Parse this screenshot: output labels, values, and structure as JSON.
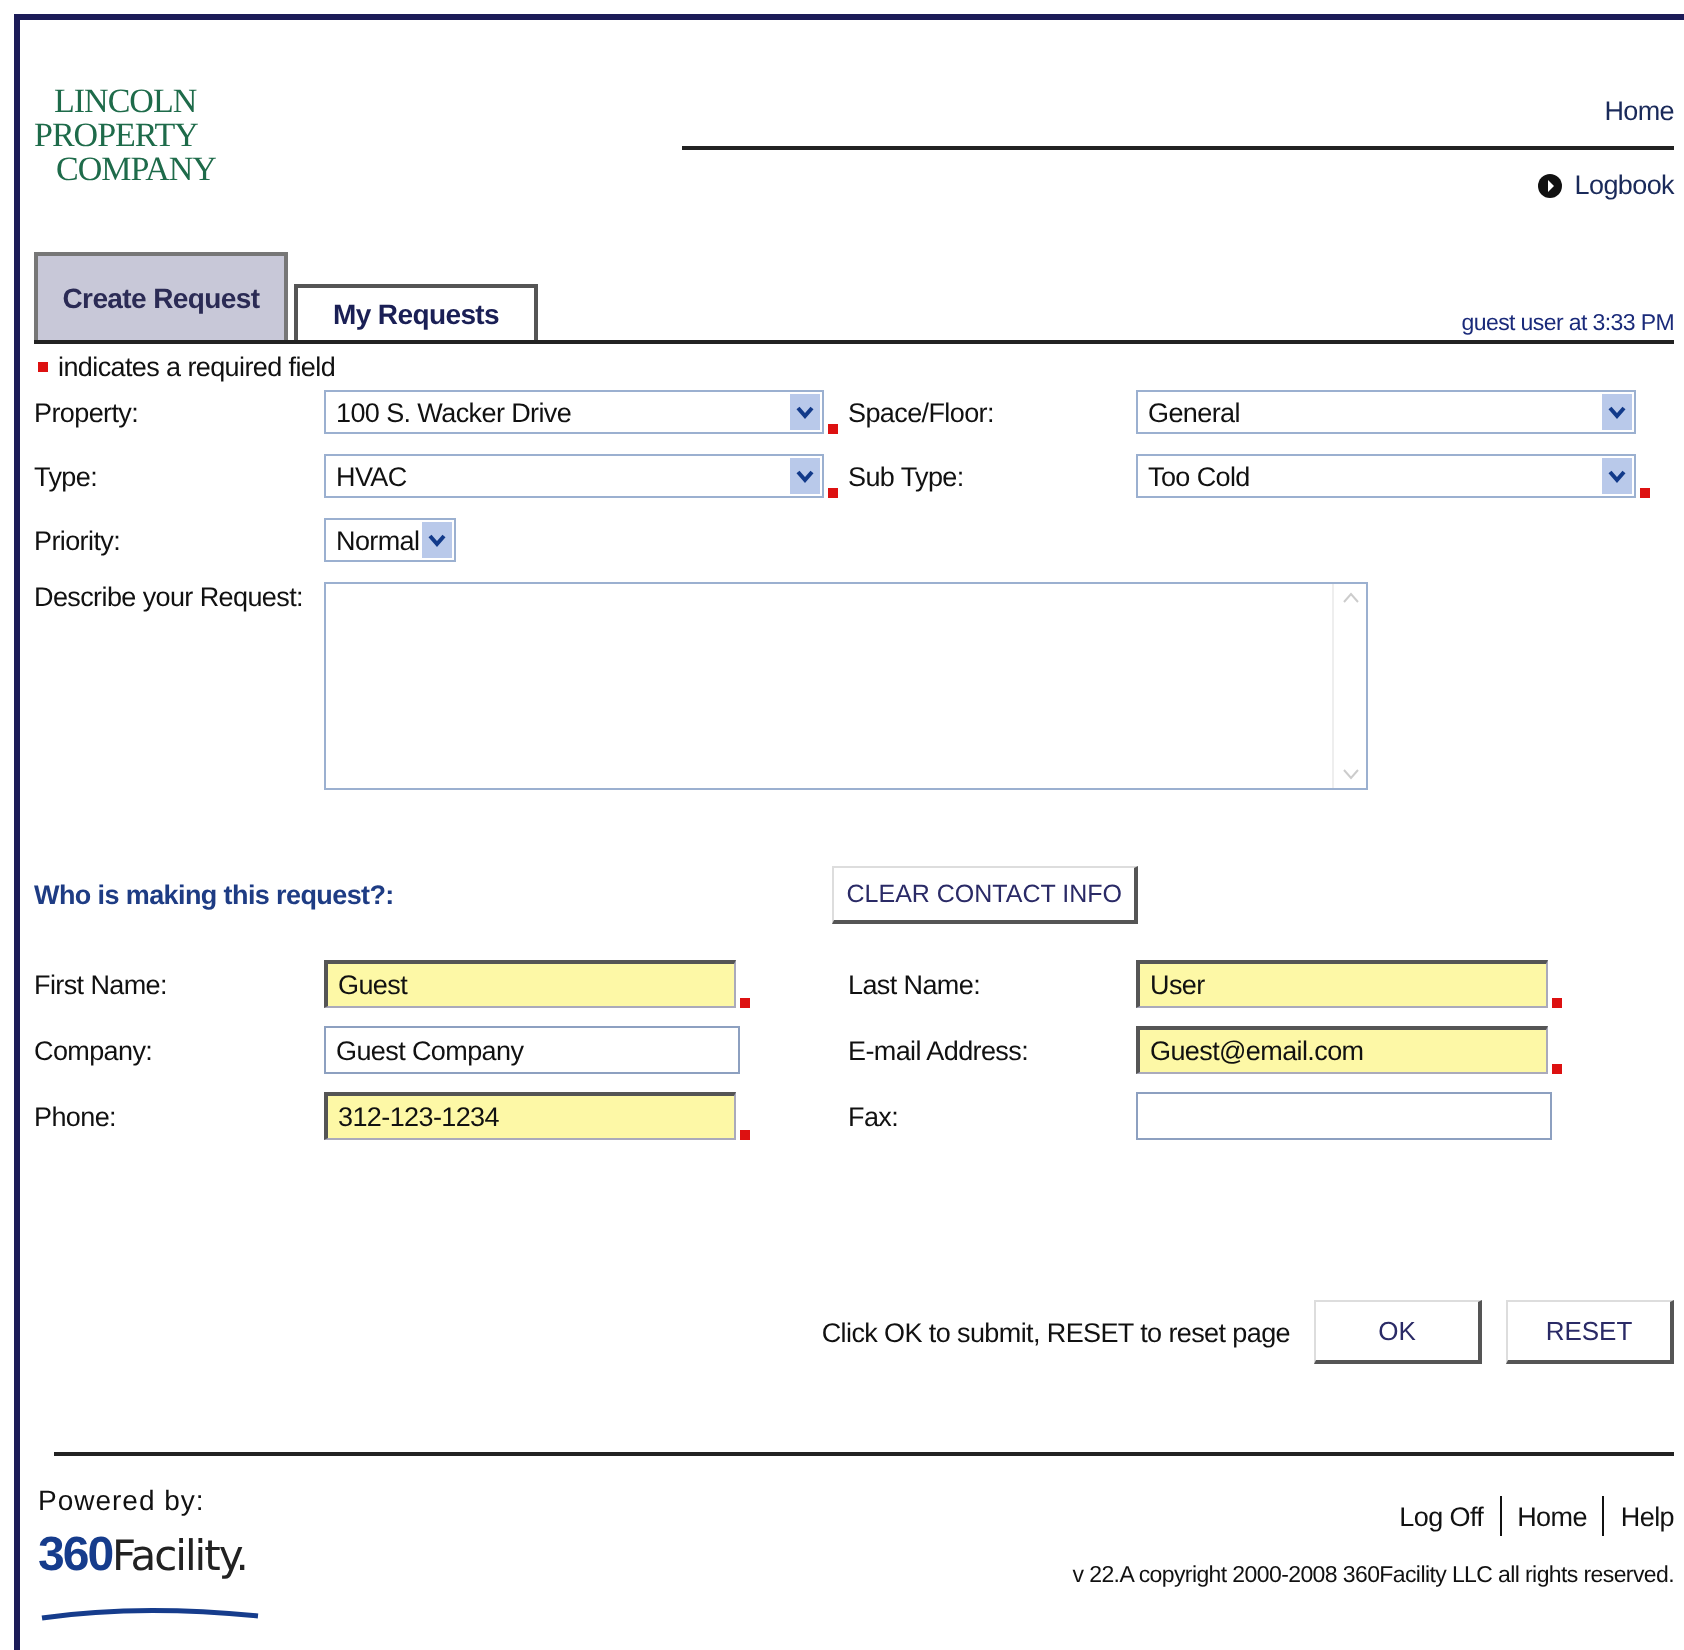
{
  "logo": {
    "lines": [
      "LINCOLN",
      "PROPERTY",
      "COMPANY"
    ]
  },
  "nav": [
    {
      "label": "Home",
      "kind": "plain"
    },
    {
      "label": "Logbook",
      "kind": "bullet"
    }
  ],
  "tabs": [
    {
      "label": "Create Request",
      "selected": true
    },
    {
      "label": "My Requests",
      "selected": false
    }
  ],
  "user_status": "guest user at 3:33 PM",
  "required_note": "indicates a required field",
  "request_fields": [
    {
      "label": "Property:",
      "value": "100 S. Wacker Drive",
      "kind": "select",
      "required": true
    },
    {
      "label": "Space/Floor:",
      "value": "General",
      "kind": "select",
      "required": false
    },
    {
      "label": "Type:",
      "value": "HVAC",
      "kind": "select",
      "required": true
    },
    {
      "label": "Sub Type:",
      "value": "Too Cold",
      "kind": "select",
      "required": true
    },
    {
      "label": "Priority:",
      "value": "Normal",
      "kind": "small-select",
      "required": false
    },
    {
      "label": "Describe your Request:",
      "kind": "textarea",
      "required": false
    }
  ],
  "contact": {
    "heading": "Who is making this request?:",
    "clear_button": "CLEAR CONTACT INFO",
    "fields": [
      {
        "label": "First Name:",
        "value": "Guest",
        "required": true
      },
      {
        "label": "Last Name:",
        "value": "User",
        "required": true
      },
      {
        "label": "Company:",
        "value": "Guest Company",
        "required": false
      },
      {
        "label": "E-mail Address:",
        "value": "Guest@email.com",
        "required": true
      },
      {
        "label": "Phone:",
        "value": "312-123-1234",
        "required": true
      },
      {
        "label": "Fax:",
        "required": false
      }
    ]
  },
  "submit_hint": "Click OK to submit, RESET to reset page",
  "buttons": [
    "OK",
    "RESET"
  ],
  "footer": {
    "powered_by": "Powered by:",
    "brand_number": "360",
    "brand_name": "Facility.",
    "links": [
      "Log Off",
      "Home",
      "Help"
    ],
    "copyright": "v 22.A copyright 2000-2008 360Facility LLC all rights reserved."
  }
}
